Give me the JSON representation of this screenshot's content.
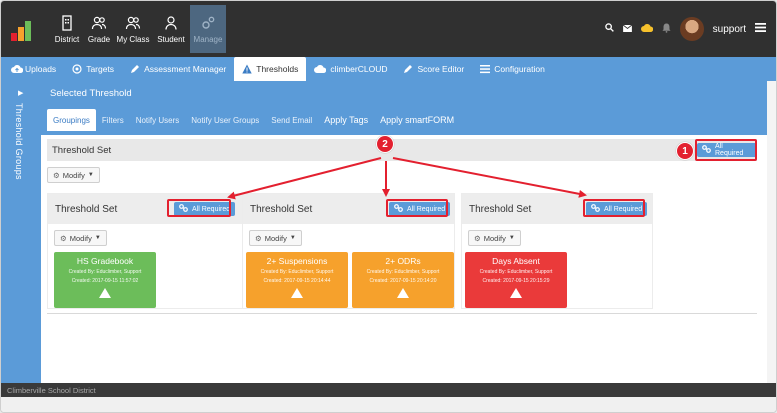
{
  "topnav": {
    "items": [
      {
        "label": "District",
        "icon": "building-icon"
      },
      {
        "label": "Grade",
        "icon": "users-icon"
      },
      {
        "label": "My Class",
        "icon": "users-icon"
      },
      {
        "label": "Student",
        "icon": "user-icon"
      },
      {
        "label": "Manage",
        "icon": "gears-icon"
      }
    ],
    "user": "support"
  },
  "subnav": {
    "items": [
      {
        "label": "Uploads",
        "icon": "cloud-upload-icon"
      },
      {
        "label": "Targets",
        "icon": "target-icon"
      },
      {
        "label": "Assessment Manager",
        "icon": "pencil-icon"
      },
      {
        "label": "Thresholds",
        "icon": "warning-icon"
      },
      {
        "label": "climberCLOUD",
        "icon": "cloud-icon"
      },
      {
        "label": "Score Editor",
        "icon": "pencil-icon"
      },
      {
        "label": "Configuration",
        "icon": "list-icon"
      }
    ]
  },
  "sidebar": {
    "label": "Threshold Groups"
  },
  "panel": {
    "title": "Selected Threshold",
    "tabs": [
      "Groupings",
      "Filters",
      "Notify Users",
      "Notify User Groups",
      "Send Email",
      "Apply Tags",
      "Apply smartFORM"
    ]
  },
  "set": {
    "label": "Threshold Set",
    "modify": "Modify",
    "all_required": "All Required"
  },
  "cards": [
    {
      "label": "Threshold Set",
      "modify": "Modify",
      "all_required": "All Required",
      "tiles": [
        {
          "name": "HS Gradebook",
          "created_by": "Created By: Educlimber, Support",
          "created": "Created: 2017-09-15 11:57:02",
          "color": "#6cbd5a"
        }
      ]
    },
    {
      "label": "Threshold Set",
      "modify": "Modify",
      "all_required": "All Required",
      "tiles": [
        {
          "name": "2+ Suspensions",
          "created_by": "Created By: Educlimber, Support",
          "created": "Created: 2017-09-15 20:14:44",
          "color": "#f6a12c"
        },
        {
          "name": "2+ ODRs",
          "created_by": "Created By: Educlimber, Support",
          "created": "Created: 2017-09-15 20:14:20",
          "color": "#f6a12c"
        }
      ]
    },
    {
      "label": "Threshold Set",
      "modify": "Modify",
      "all_required": "All Required",
      "tiles": [
        {
          "name": "Days Absent",
          "created_by": "Created By: Educlimber, Support",
          "created": "Created: 2017-09-15 20:15:29",
          "color": "#ea3a3a"
        }
      ]
    }
  ],
  "callouts": [
    "1",
    "2"
  ],
  "footer": "Climberville School District",
  "colors": {
    "accent": "#5b9bd8",
    "highlight": "#e3202f",
    "topbar": "#303030"
  }
}
